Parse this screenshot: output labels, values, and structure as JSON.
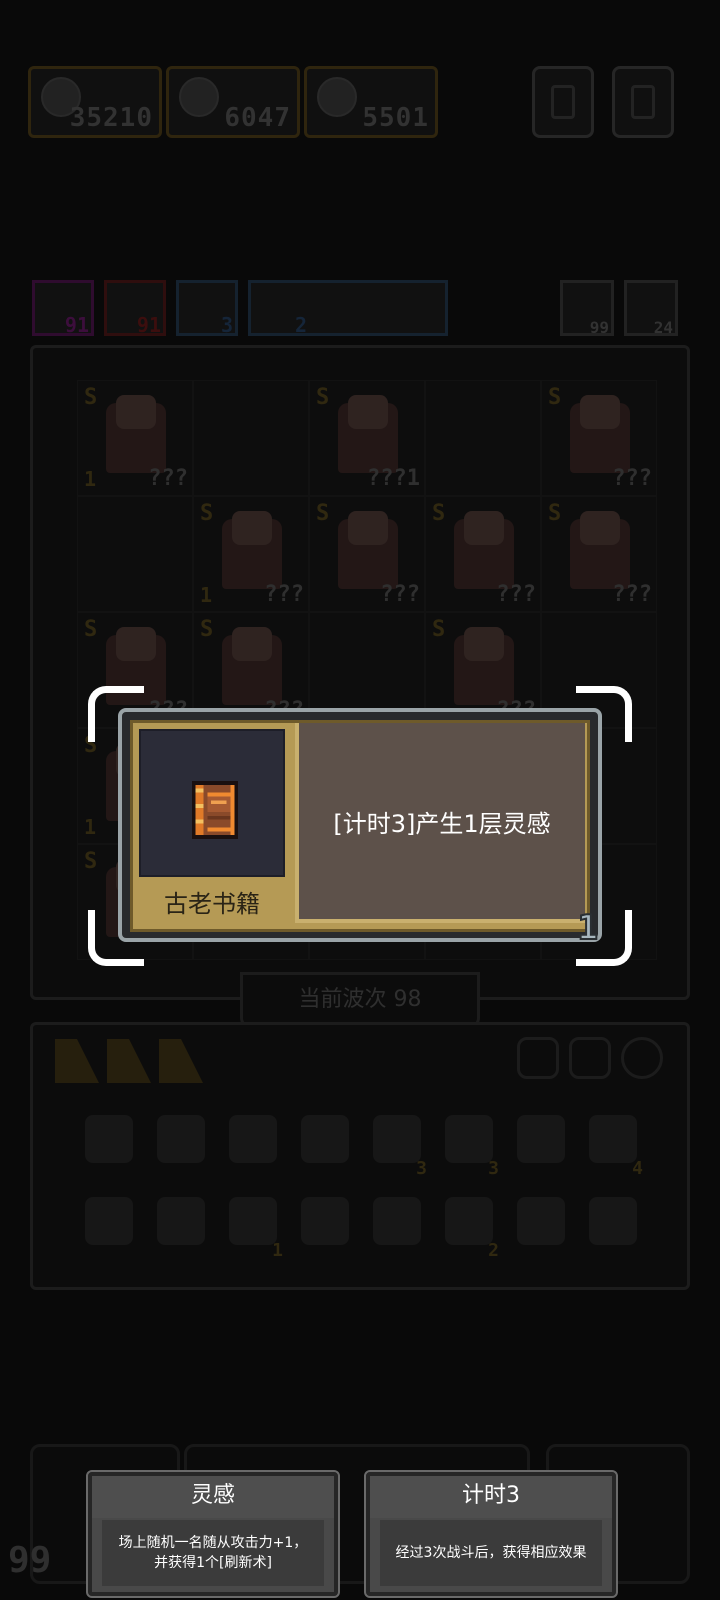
{
  "resources": [
    {
      "icon": "crystal-icon",
      "value": "35210"
    },
    {
      "icon": "skull-icon",
      "value": "6047"
    },
    {
      "icon": "skull-icon",
      "value": "5501"
    }
  ],
  "counters": {
    "left": "99",
    "right": "24"
  },
  "status_chips": [
    {
      "count": "91",
      "color": "#6a1a6a"
    },
    {
      "count": "91",
      "color": "#5a1a1a"
    },
    {
      "count": "3",
      "color": "#1a3a5a"
    },
    {
      "count": "2",
      "color": "#1a3a5a"
    }
  ],
  "board": {
    "cells": [
      {
        "filled": true,
        "rank": "S",
        "lvl": "1",
        "name": "???"
      },
      {
        "filled": false
      },
      {
        "filled": true,
        "rank": "S",
        "lvl": "",
        "name": "???1"
      },
      {
        "filled": false
      },
      {
        "filled": true,
        "rank": "S",
        "lvl": "",
        "name": "???"
      },
      {
        "filled": false
      },
      {
        "filled": true,
        "rank": "S",
        "lvl": "1",
        "name": "???"
      },
      {
        "filled": true,
        "rank": "S",
        "lvl": "",
        "name": "???"
      },
      {
        "filled": true,
        "rank": "S",
        "lvl": "",
        "name": "???"
      },
      {
        "filled": true,
        "rank": "S",
        "lvl": "",
        "name": "???"
      },
      {
        "filled": true,
        "rank": "S",
        "lvl": "",
        "name": "???"
      },
      {
        "filled": true,
        "rank": "S",
        "lvl": "",
        "name": "???"
      },
      {
        "filled": false
      },
      {
        "filled": true,
        "rank": "S",
        "lvl": "",
        "name": "???"
      },
      {
        "filled": false
      },
      {
        "filled": true,
        "rank": "S",
        "lvl": "1",
        "name": ""
      },
      {
        "filled": false
      },
      {
        "filled": false
      },
      {
        "filled": false
      },
      {
        "filled": false
      },
      {
        "filled": true,
        "rank": "S",
        "lvl": "",
        "name": ""
      },
      {
        "filled": false
      },
      {
        "filled": false
      },
      {
        "filled": false
      },
      {
        "filled": false
      }
    ]
  },
  "wave_label": "当前波次 98",
  "relics": [
    {
      "icon": "shield-icon",
      "count": ""
    },
    {
      "icon": "mask-icon",
      "count": ""
    },
    {
      "icon": "demon-mask-icon",
      "count": ""
    },
    {
      "icon": "horned-helmet-icon",
      "count": ""
    },
    {
      "icon": "lock-icon",
      "count": "3"
    },
    {
      "icon": "figure-icon",
      "count": "3"
    },
    {
      "icon": "molecule-icon",
      "count": ""
    },
    {
      "icon": "water-drop-icon",
      "count": "4"
    },
    {
      "icon": "star-wand-icon",
      "count": ""
    },
    {
      "icon": "potion-icon",
      "count": ""
    },
    {
      "icon": "book-icon",
      "count": "1"
    },
    {
      "icon": "eye-glyph-icon",
      "count": ""
    },
    {
      "icon": "rune-frame-icon",
      "count": ""
    },
    {
      "icon": "planet-icon",
      "count": "2"
    },
    {
      "icon": "chest-icon",
      "count": ""
    },
    {
      "icon": "jar-icon",
      "count": ""
    }
  ],
  "refresh_count": "99",
  "item": {
    "name": "古老书籍",
    "description": "[计时3]产生1层灵感",
    "count": "1",
    "icon": "ancient-book-icon"
  },
  "tooltips": [
    {
      "title": "灵感",
      "body": "场上随机一名随从攻击力+1，并获得1个[刷新术]"
    },
    {
      "title": "计时3",
      "body": "经过3次战斗后，获得相应效果"
    }
  ]
}
